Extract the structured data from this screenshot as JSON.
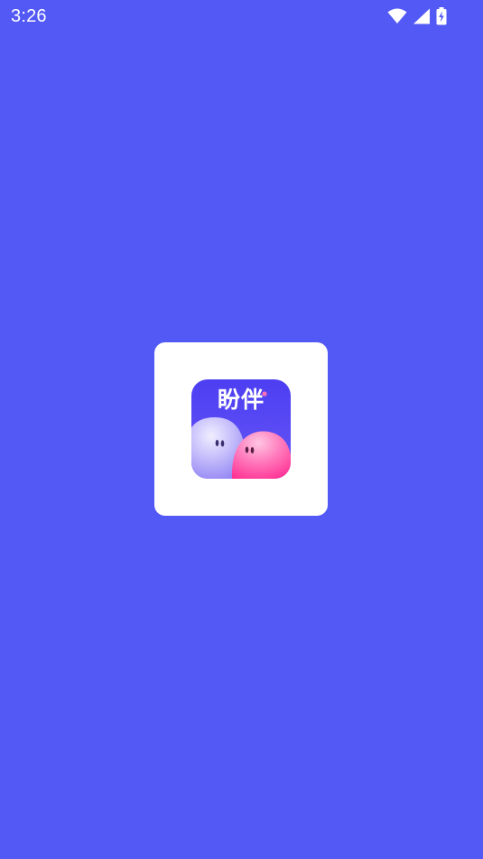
{
  "status_bar": {
    "time": "3:26",
    "icons": [
      "wifi-icon",
      "cellular-signal-icon",
      "battery-charging-icon"
    ]
  },
  "splash": {
    "app_name": "盼伴",
    "logo_icon": "app-logo-icon",
    "colors": {
      "background": "#5359F5",
      "card": "#FFFFFF",
      "logo_bg": "#4D3FF2",
      "blob_purple": "#A49BF6",
      "blob_pink": "#FF4FA3"
    }
  }
}
